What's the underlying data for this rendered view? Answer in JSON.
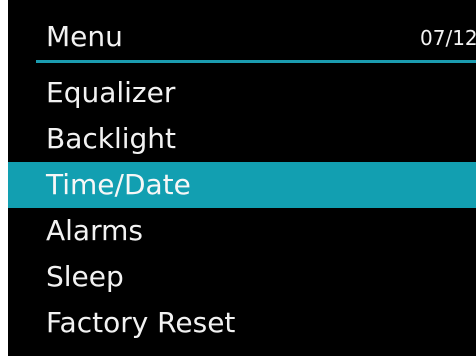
{
  "header": {
    "title": "Menu",
    "page_counter": "07/12"
  },
  "menu": {
    "items": [
      {
        "label": "Equalizer",
        "selected": false
      },
      {
        "label": "Backlight",
        "selected": false
      },
      {
        "label": "Time/Date",
        "selected": true
      },
      {
        "label": "Alarms",
        "selected": false
      },
      {
        "label": "Sleep",
        "selected": false
      },
      {
        "label": "Factory Reset",
        "selected": false
      }
    ]
  },
  "colors": {
    "background": "#000000",
    "accent": "#129fb1",
    "text": "#f2f2f2"
  }
}
